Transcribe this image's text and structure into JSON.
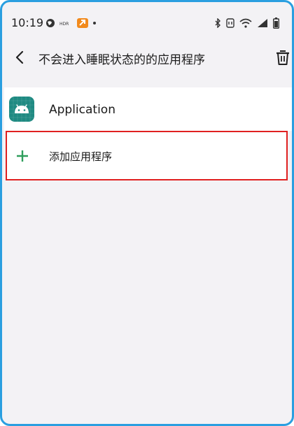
{
  "status_bar": {
    "time": "10:19",
    "indicator_text": "HDR",
    "icons": [
      "globe-icon",
      "hdr-icon",
      "app-notification-icon",
      "notification-dot",
      "bluetooth-icon",
      "nfc-icon",
      "wifi-icon",
      "signal-icon",
      "battery-icon"
    ]
  },
  "header": {
    "title": "不会进入睡眠状态的的应用程序",
    "back_icon": "back-icon",
    "delete_icon": "trash-icon"
  },
  "apps": [
    {
      "label": "Application",
      "icon": "android-app-icon"
    }
  ],
  "add_app": {
    "label": "添加应用程序",
    "icon": "plus-icon"
  },
  "colors": {
    "frame_border": "#2a9fe0",
    "background": "#f3f2f5",
    "app_icon_bg": "#1f8a82",
    "plus_color": "#2e9e5b",
    "highlight_border": "#e02020"
  }
}
